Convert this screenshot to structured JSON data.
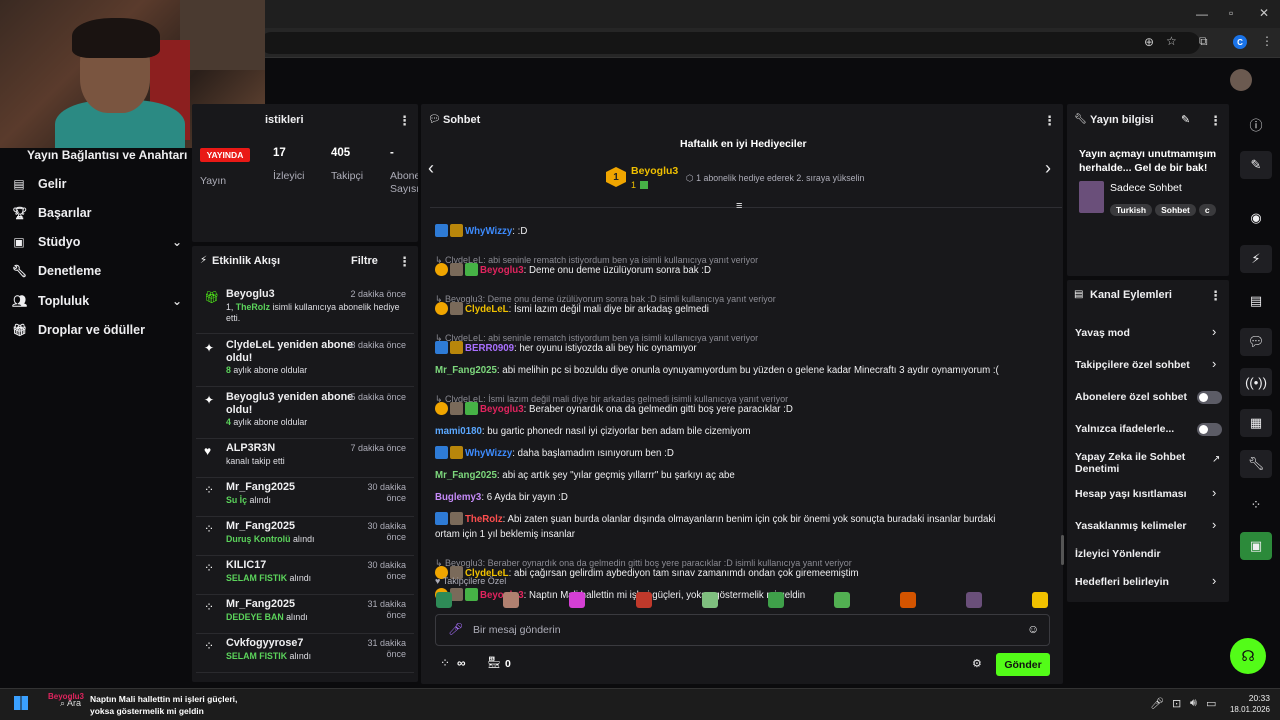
{
  "browser": {
    "profile_letter": "C"
  },
  "left_nav": {
    "section_title": "Yayın Bağlantısı ve Anahtarı",
    "items": [
      {
        "label": "Gelir",
        "icon": "wallet-icon"
      },
      {
        "label": "Başarılar",
        "icon": "trophy-icon"
      },
      {
        "label": "Stüdyo",
        "icon": "studio-icon"
      },
      {
        "label": "Denetleme",
        "icon": "wrench-icon"
      },
      {
        "label": "Topluluk",
        "icon": "people-icon"
      },
      {
        "label": "Droplar ve ödüller",
        "icon": "gift-icon"
      }
    ]
  },
  "stats": {
    "title_partial": "istikleri",
    "live_badge": "YAYINDA",
    "items": [
      {
        "value": "",
        "label": "Yayın"
      },
      {
        "value": "17",
        "label": "İzleyici"
      },
      {
        "value": "405",
        "label": "Takipçi"
      },
      {
        "value": "-",
        "label": "Abone\nSayısı"
      }
    ]
  },
  "activity": {
    "title": "Etkinlik Akışı",
    "filter_label": "Filtre",
    "rows": [
      {
        "name": "Beyoglu3",
        "time": "2 dakika önce",
        "pre": "1, ",
        "hl": "TheRolz",
        "post": " isimli kullanıcıya abonelik hediye etti.",
        "icon": "gift-icon"
      },
      {
        "name": "ClydeLeL yeniden abone oldu!",
        "time": "3 dakika önce",
        "pre": "",
        "hl": "8",
        "post": " aylık abone oldular",
        "icon": "sparkle-icon"
      },
      {
        "name": "Beyoglu3 yeniden abone oldu!",
        "time": "5 dakika önce",
        "pre": "",
        "hl": "4",
        "post": " aylık abone oldular",
        "icon": "sparkle-icon"
      },
      {
        "name": "ALP3R3N",
        "time": "7 dakika önce",
        "pre": "",
        "hl": "",
        "post": "kanalı takip etti",
        "icon": "heart-icon"
      },
      {
        "name": "Mr_Fang2025",
        "time": "30 dakika önce",
        "pre": "",
        "hl": "Su İç",
        "post": " alındı",
        "icon": "points-icon"
      },
      {
        "name": "Mr_Fang2025",
        "time": "30 dakika önce",
        "pre": "",
        "hl": "Duruş Kontrolü",
        "post": " alındı",
        "icon": "points-icon"
      },
      {
        "name": "KILIC17",
        "time": "30 dakika önce",
        "pre": "",
        "hl": "SELAM FISTIK",
        "post": " alındı",
        "icon": "points-icon"
      },
      {
        "name": "Mr_Fang2025",
        "time": "31 dakika önce",
        "pre": "",
        "hl": "DEDEYE BAN",
        "post": " alındı",
        "icon": "points-icon"
      },
      {
        "name": "Cvkfogyyrose7",
        "time": "31 dakika önce",
        "pre": "",
        "hl": "SELAM FISTIK",
        "post": " alındı",
        "icon": "points-icon"
      }
    ]
  },
  "chat": {
    "title": "Sohbet",
    "leaderboard_title": "Haftalık en iyi Hediyeciler",
    "leader_name": "Beyoglu3",
    "leader_rank": "1",
    "leader_count": "1",
    "leader_hint": "1 abonelik hediye ederek 2. sıraya yükselin",
    "messages": [
      {
        "reply": "",
        "user": "WhyWizzy",
        "color": "#3d8bfd",
        "text": ": :D",
        "badges": [
          "b-blue",
          "b-crown"
        ]
      },
      {
        "reply": "ClydeLeL: abi seninle rematch istiyordum ben ya isimli kullanıcıya yanıt veriyor",
        "user": "Beyoglu3",
        "color": "#e0245e",
        "text": ": Deme onu deme üzülüyorum sonra bak :D",
        "badges": [
          "b-gold",
          "b-img",
          "b-gift"
        ]
      },
      {
        "reply": "Beyoglu3: Deme onu deme üzülüyorum sonra bak :D isimli kullanıcıya yanıt veriyor",
        "user": "ClydeLeL",
        "color": "#f0c000",
        "text": ": İsmi lazım değil mali diye bir arkadaş gelmedi",
        "badges": [
          "b-gold",
          "b-img"
        ]
      },
      {
        "reply": "ClydeLeL: abi seninle rematch istiyordum ben ya isimli kullanıcıya yanıt veriyor",
        "user": "BERR0909",
        "color": "#a970ff",
        "text": ": her oyunu istiyozda ali bey hic oynamıyor",
        "badges": [
          "b-blue",
          "b-crown"
        ]
      },
      {
        "reply": "",
        "user": "Mr_Fang2025",
        "color": "#7dd87d",
        "text": ": abi melihin pc si bozuldu diye onunla oynuyamıyordum bu yüzden o gelene kadar Minecraftı 3 aydır oynamıyorum :(",
        "badges": []
      },
      {
        "reply": "ClydeLeL: İsmi lazım değil mali diye bir arkadaş gelmedi isimli kullanıcıya yanıt veriyor",
        "user": "Beyoglu3",
        "color": "#e0245e",
        "text": ": Beraber oynardık ona da gelmedin gitti boş yere paracıklar :D",
        "badges": [
          "b-gold",
          "b-img",
          "b-gift"
        ]
      },
      {
        "reply": "",
        "user": "mami0180",
        "color": "#5ba8ff",
        "text": ": bu gartic phonedr nasıl iyi çiziyorlar ben adam bile cizemiyom",
        "badges": []
      },
      {
        "reply": "",
        "user": "WhyWizzy",
        "color": "#3d8bfd",
        "text": ": daha başlamadım ısınıyorum ben :D",
        "badges": [
          "b-blue",
          "b-crown"
        ]
      },
      {
        "reply": "",
        "user": "Mr_Fang2025",
        "color": "#7dd87d",
        "text": ": abi aç artık şey \"yılar geçmiş yıllarrr\" bu şarkıyı aç abe",
        "badges": []
      },
      {
        "reply": "",
        "user": "Buglemy3",
        "color": "#c58af9",
        "text": ": 6 Ayda bir yayın :D",
        "badges": []
      },
      {
        "reply": "",
        "user": "TheRolz",
        "color": "#ff4f4f",
        "text": ": Abi zaten şuan burda olanlar dışında olmayanların benim için çok bir önemi yok sonuçta buradaki insanlar burdaki",
        "text2": "ortam için 1 yıl beklemiş insanlar",
        "badges": [
          "b-blue",
          "b-img"
        ]
      },
      {
        "reply": "Beyoglu3: Beraber oynardık ona da gelmedin gitti boş yere paracıklar :D isimli kullanıcıya yanıt veriyor",
        "user": "ClydeLeL",
        "color": "#f0c000",
        "text": ": abi çağırsan gelirdim aybediyon tam sınav zamanımdı ondan çok giremeemiştim",
        "badges": [
          "b-gold",
          "b-img"
        ]
      },
      {
        "reply": "",
        "user": "Beyoglu3",
        "color": "#e0245e",
        "text": ": Naptın Mali hallettin mi işleri güçleri, yoksa göstermelik mi geldin",
        "badges": [
          "b-gold",
          "b-img",
          "b-gift"
        ]
      }
    ],
    "followers_label": "Takipçilere Özel",
    "input_placeholder": "Bir mesaj gönderin",
    "points": "∞",
    "store_count": "0",
    "send_label": "Gönder"
  },
  "stream_info": {
    "title": "Yayın bilgisi",
    "stream_title": "Yayın açmayı unutmamışım herhalde... Gel de bir bak!",
    "category": "Sadece Sohbet",
    "tags": [
      "Turkish",
      "Sohbet",
      "c"
    ]
  },
  "channel_actions": {
    "title": "Kanal Eylemleri",
    "items": [
      {
        "label": "Yavaş mod",
        "control": "chevron"
      },
      {
        "label": "Takipçilere özel sohbet",
        "control": "chevron"
      },
      {
        "label": "Abonelere özel sohbet",
        "control": "toggle"
      },
      {
        "label": "Yalnızca ifadelerle...",
        "control": "toggle"
      },
      {
        "label": "Yapay Zeka ile Sohbet Denetimi",
        "control": "external"
      },
      {
        "label": "Hesap yaşı kısıtlaması",
        "control": "chevron"
      },
      {
        "label": "Yasaklanmış kelimeler",
        "control": "chevron"
      },
      {
        "label": "İzleyici Yönlendir",
        "control": "none"
      },
      {
        "label": "Hedefleri belirleyin",
        "control": "chevron"
      }
    ]
  },
  "taskbar": {
    "search_label": "Ara",
    "notif_user": "Beyoglu3",
    "notif_text": "Naptın Mali hallettin mi işleri güçleri, yoksa göstermelik mi geldin",
    "time": "20:33",
    "date": "18.01.2026"
  }
}
